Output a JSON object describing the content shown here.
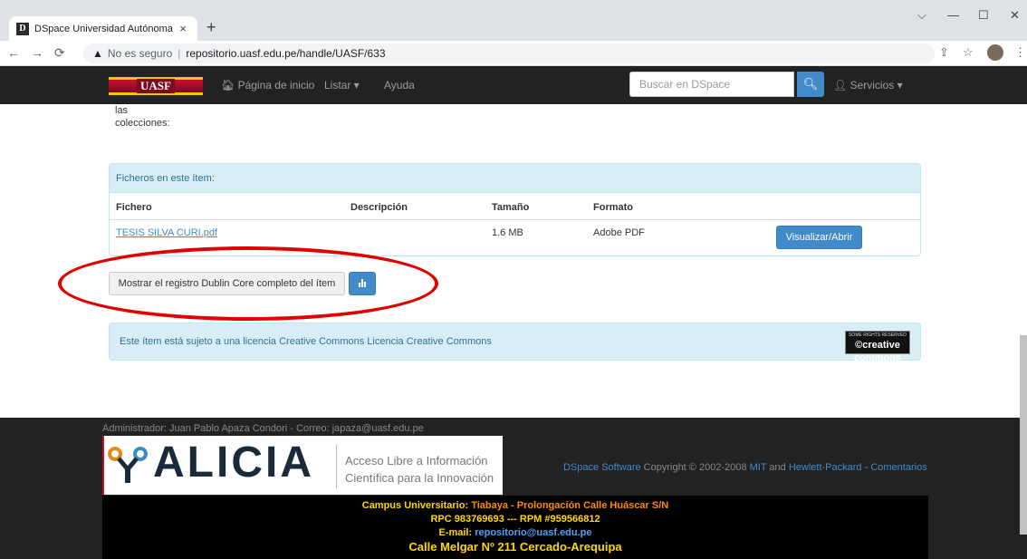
{
  "browser": {
    "tab_title": "DSpace Universidad Autónoma S",
    "tab_close": "×",
    "new_tab": "+",
    "insecure_label": "No es seguro",
    "url": "repositorio.uasf.edu.pe/handle/UASF/633",
    "favicon_letter": "D"
  },
  "nav": {
    "logo": "UASF",
    "home": "Página de inicio",
    "list": "Listar ▾",
    "help": "Ayuda",
    "search_placeholder": "Buscar en DSpace",
    "services": "Servicios ▾"
  },
  "main": {
    "cut_line1": "las",
    "cut_line2": "colecciones:",
    "files_panel": {
      "title": "Ficheros en este ítem:",
      "headers": [
        "Fichero",
        "Descripción",
        "Tamaño",
        "Formato"
      ],
      "rows": [
        {
          "file": "TESIS SILVA CURI.pdf",
          "description": "",
          "size": "1.6 MB",
          "format": "Adobe PDF",
          "action": "Visualizar/Abrir"
        }
      ]
    },
    "dublin_core_button": "Mostrar el registro Dublin Core completo del ítem",
    "license_text": "Este ítem está sujeto a una licencia Creative Commons Licencia Creative Commons",
    "cc_badge_top": "SOME RIGHTS RESERVED",
    "cc_badge_main": "©creative commons"
  },
  "footer": {
    "admin": "Administrador: Juan Pablo Apaza Condori - Correo: japaza@uasf.edu.pe",
    "alicia_word": "ALICIA",
    "alicia_tag1": "Acceso Libre a Información",
    "alicia_tag2": "Científica para la Innovación",
    "dspace_link": "DSpace Software",
    "copy_mid": " Copyright © 2002-2008 ",
    "mit_link": "MIT",
    "and_text": " and ",
    "hp_link": "Hewlett-Packard",
    "dash": " - ",
    "comments_link": "Comentarios",
    "campus_label": "Campus Universitario:",
    "campus_value": "Tiabaya - Prolongación Calle Huáscar S/N",
    "phones": "RPC 983769693 --- RPM #959566812",
    "email_label": "E-mail:",
    "email_value": "repositorio@uasf.edu.pe",
    "address": "Calle Melgar Nº 211  Cercado-Arequipa"
  },
  "colors": {
    "accent": "#428bca",
    "highlight_ellipse": "#e00000",
    "panel_info": "#d9edf7",
    "footer_bg": "#222222"
  }
}
